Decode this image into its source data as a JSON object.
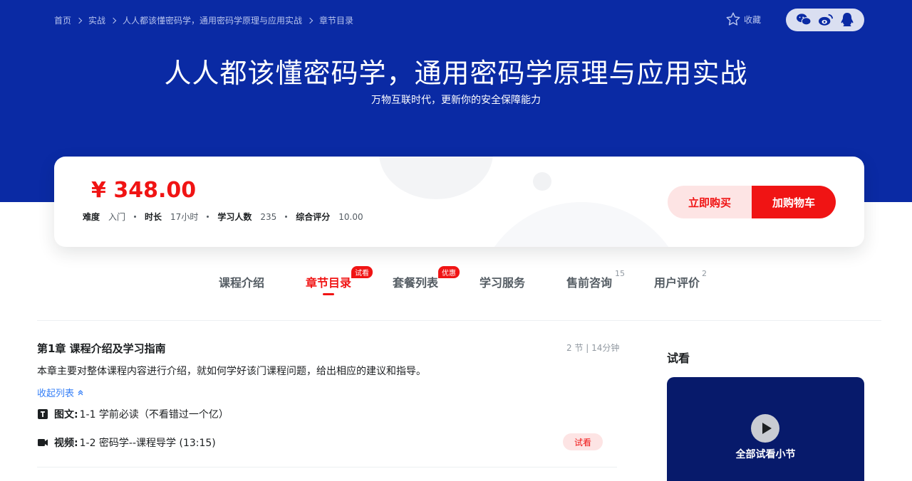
{
  "breadcrumb": [
    "首页",
    "实战",
    "人人都该懂密码学，通用密码学原理与应用实战",
    "章节目录"
  ],
  "favorite_label": "收藏",
  "course": {
    "title": "人人都该懂密码学，通用密码学原理与应用实战",
    "subtitle": "万物互联时代，更新你的安全保障能力"
  },
  "price_card": {
    "price": "¥ 348.00",
    "meta": [
      {
        "label": "难度",
        "value": "入门"
      },
      {
        "label": "时长",
        "value": "17小时"
      },
      {
        "label": "学习人数",
        "value": "235"
      },
      {
        "label": "综合评分",
        "value": "10.00"
      }
    ],
    "buy_label": "立即购买",
    "cart_label": "加购物车"
  },
  "tabs": [
    {
      "label": "课程介绍"
    },
    {
      "label": "章节目录",
      "badge": "试看",
      "active": true
    },
    {
      "label": "套餐列表",
      "badge": "优惠"
    },
    {
      "label": "学习服务"
    },
    {
      "label": "售前咨询",
      "count": "15"
    },
    {
      "label": "用户评价",
      "count": "2"
    }
  ],
  "chapter": {
    "title": "第1章 课程介绍及学习指南",
    "stat": "2 节 | 14分钟",
    "description": "本章主要对整体课程内容进行介绍，就如何学好该门课程问题，给出相应的建议和指导。",
    "collapse_label": "收起列表",
    "lessons": [
      {
        "type": "图文:",
        "title": "1-1 学前必读（不看错过一个亿）"
      },
      {
        "type": "视频:",
        "title": "1-2 密码学--课程导学 (13:15)",
        "tag": "试看"
      }
    ]
  },
  "sidebar": {
    "title": "试看",
    "card_label": "全部试看小节"
  },
  "colors": {
    "hero_bg": "#0a2aa4",
    "accent_red": "#f01414",
    "link_blue": "#3780f7"
  }
}
